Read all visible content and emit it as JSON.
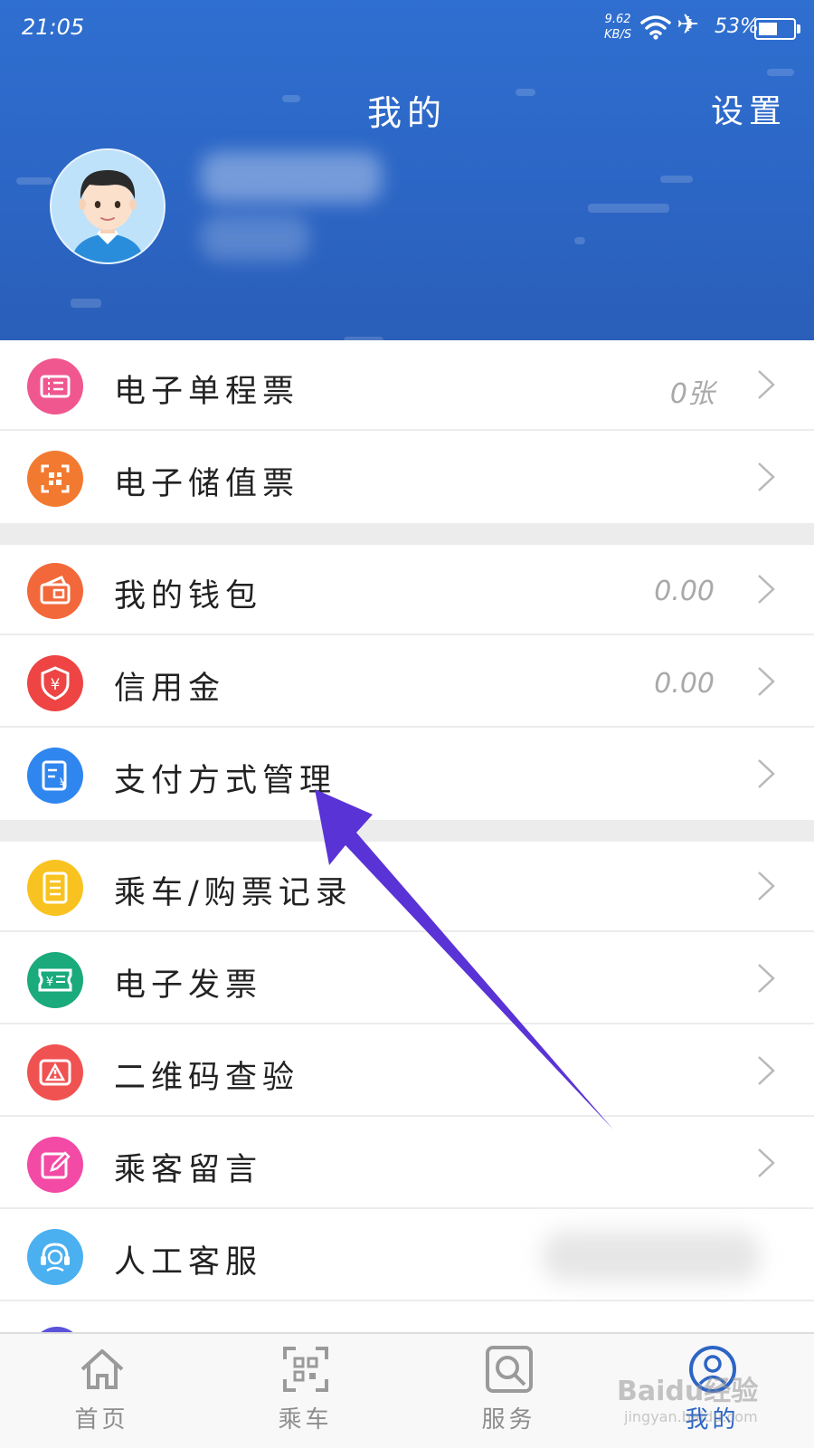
{
  "status_bar": {
    "time": "21:05",
    "net_speed": "9.62",
    "net_unit": "KB/S",
    "battery": "53%"
  },
  "header": {
    "title": "我的",
    "settings": "设置"
  },
  "menu": [
    {
      "label": "电子单程票",
      "value": "0张",
      "color": "#f0578f",
      "icon": "ticket-icon"
    },
    {
      "label": "电子储值票",
      "value": "",
      "color": "#f27a30",
      "icon": "qr-card-icon"
    },
    {
      "label": "我的钱包",
      "value": "0.00",
      "color": "#f2683a",
      "icon": "wallet-icon"
    },
    {
      "label": "信用金",
      "value": "0.00",
      "color": "#ee4444",
      "icon": "shield-yuan-icon"
    },
    {
      "label": "支付方式管理",
      "value": "",
      "color": "#2f86ef",
      "icon": "payment-doc-icon"
    },
    {
      "label": "乘车/购票记录",
      "value": "",
      "color": "#f8c320",
      "icon": "record-list-icon"
    },
    {
      "label": "电子发票",
      "value": "",
      "color": "#1aaa7c",
      "icon": "invoice-icon"
    },
    {
      "label": "二维码查验",
      "value": "",
      "color": "#f05252",
      "icon": "warning-triangle-icon"
    },
    {
      "label": "乘客留言",
      "value": "",
      "color": "#f24aa5",
      "icon": "edit-icon"
    },
    {
      "label": "人工客服",
      "value": "",
      "color": "#4ab0f0",
      "icon": "headset-icon"
    }
  ],
  "tabs": [
    {
      "label": "首页",
      "icon": "home-icon"
    },
    {
      "label": "乘车",
      "icon": "scan-icon"
    },
    {
      "label": "服务",
      "icon": "search-icon"
    },
    {
      "label": "我的",
      "icon": "profile-icon"
    }
  ],
  "watermark": {
    "text": "Baidu经验",
    "sub": "jingyan.baidu.com"
  },
  "colors": {
    "header": "#2c65c4",
    "arrow": "#5a33d6",
    "active_tab": "#2c65c4"
  }
}
